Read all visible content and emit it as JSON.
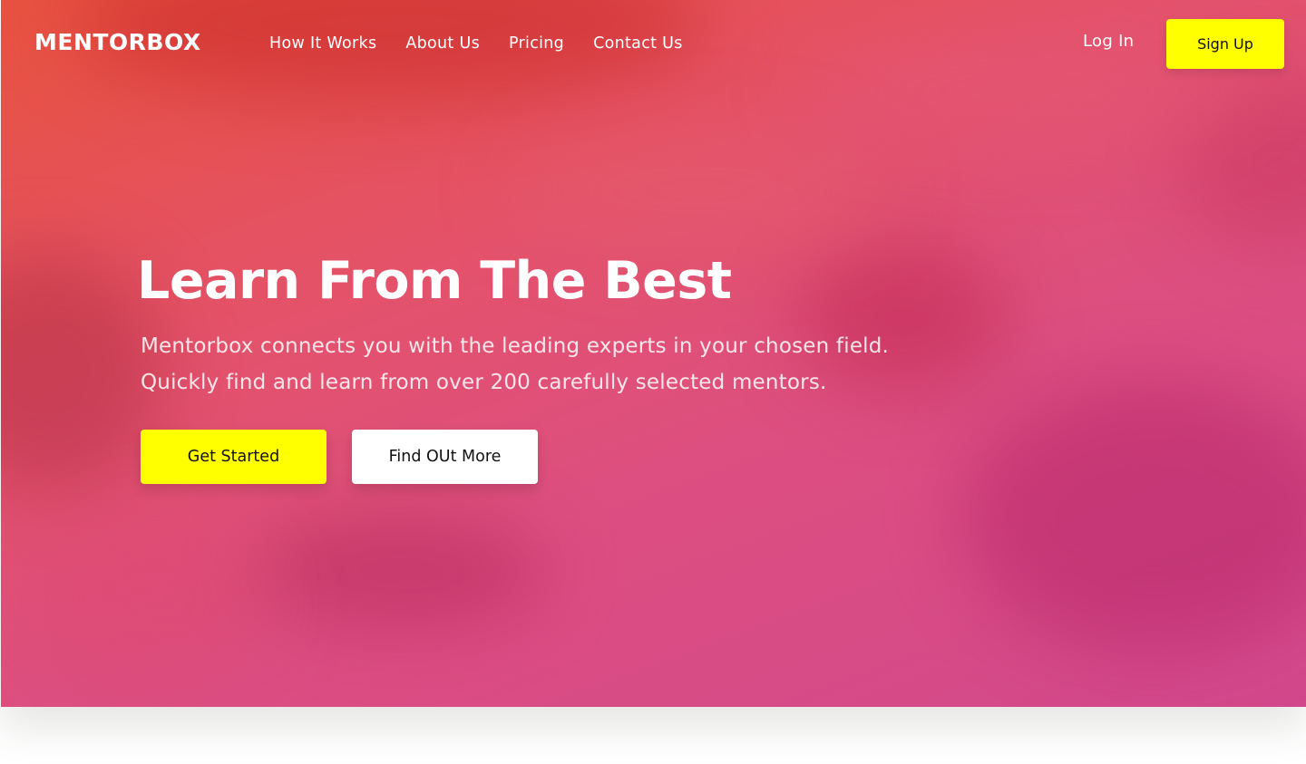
{
  "brand": {
    "logo": "MENTORBOX"
  },
  "nav": {
    "items": [
      {
        "label": "How It Works"
      },
      {
        "label": "About Us"
      },
      {
        "label": "Pricing"
      },
      {
        "label": "Contact Us"
      }
    ],
    "login_label": "Log In",
    "signup_label": "Sign Up"
  },
  "hero": {
    "headline": "Learn From The Best",
    "subtitle_lines": [
      "Mentorbox connects you with the leading experts in your chosen field.",
      "Quickly find and learn from over 200 carefully selected mentors."
    ],
    "primary_cta": "Get Started",
    "secondary_cta": "Find OUt More"
  },
  "colors": {
    "accent_yellow": "#ffff00",
    "gradient_start": "#e8523f",
    "gradient_end": "#d2488c",
    "text_light": "#ffffff"
  }
}
